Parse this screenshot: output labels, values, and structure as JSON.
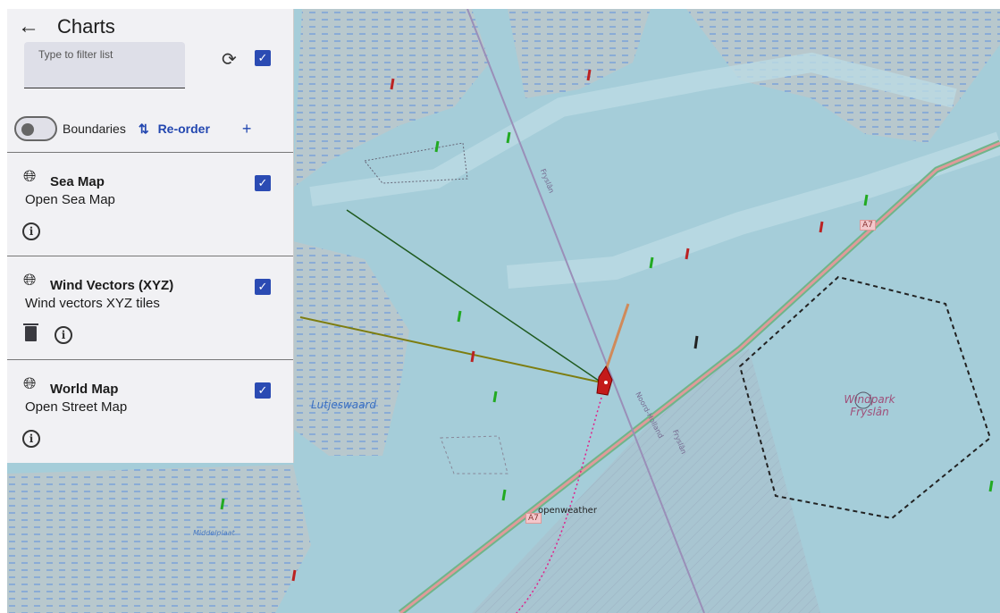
{
  "panel": {
    "title": "Charts",
    "filter_placeholder": "Type to filter list",
    "select_all_checked": true,
    "boundaries_label": "Boundaries",
    "boundaries_on": false,
    "reorder_label": "Re-order",
    "add_label": "+",
    "items": [
      {
        "name": "Sea Map",
        "description": "Open Sea Map",
        "checked": true,
        "deletable": false
      },
      {
        "name": "Wind Vectors (XYZ)",
        "description": "Wind vectors XYZ tiles",
        "checked": true,
        "deletable": true
      },
      {
        "name": "World Map",
        "description": "Open Street Map",
        "checked": true,
        "deletable": false
      }
    ]
  },
  "map": {
    "labels": {
      "lutjeswaard": "Lutjeswaard",
      "windpark": "Windpark Fryslân",
      "middelplaat": "Middelplaat",
      "openweather": "openweather",
      "road_a7": "A7",
      "road_a7_2": "A7",
      "fryslan_top": "Fryslân",
      "fryslan_bottom": "Fryslân",
      "noord_holland": "Noord-Holland"
    },
    "colors": {
      "water": "#a5cdd9",
      "land": "#b8c8cd",
      "road": "#e09a9a",
      "accent": "#2b4bb3"
    }
  }
}
